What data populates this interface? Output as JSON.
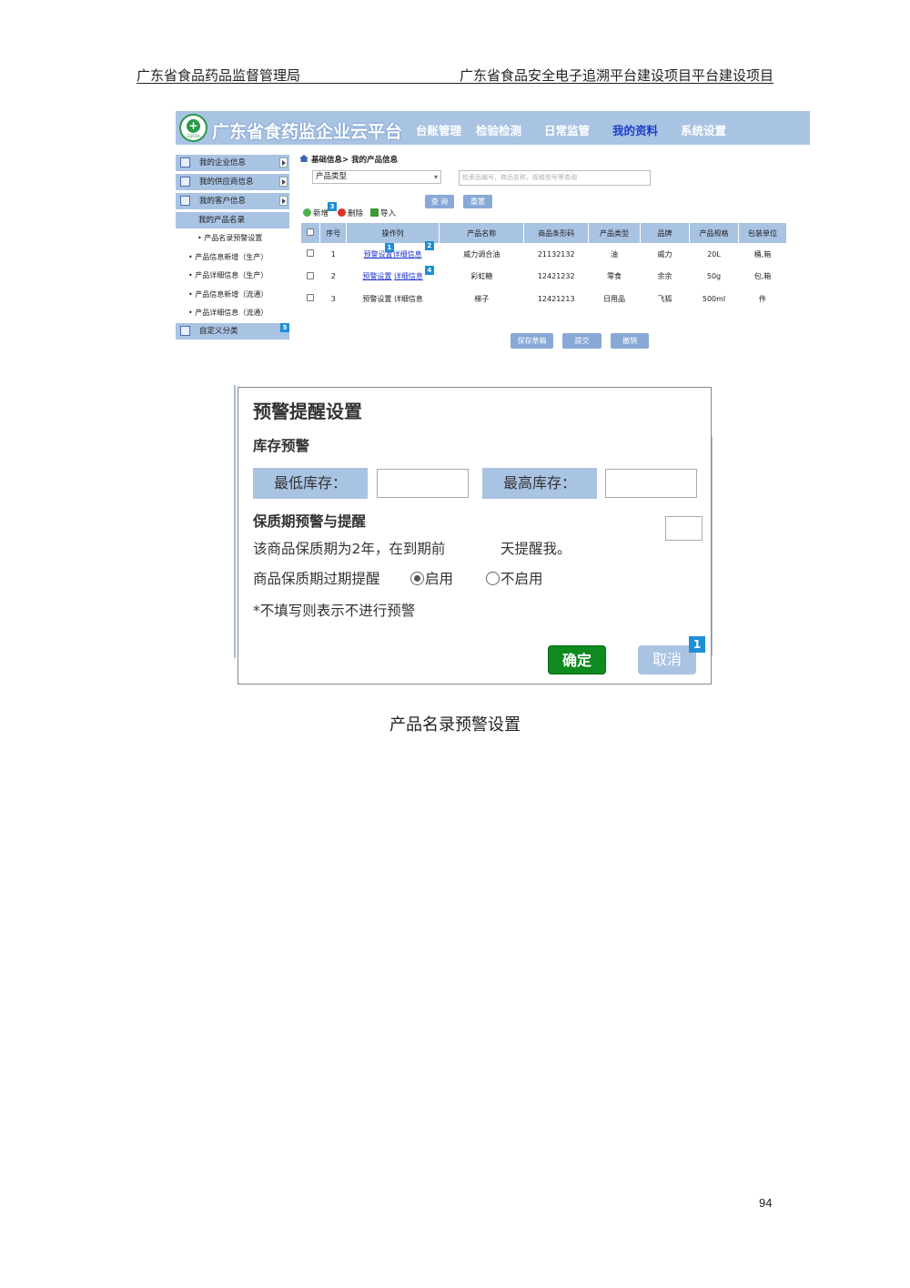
{
  "header": {
    "left": "广东省食品药品监督管理局",
    "right": "广东省食品安全电子追溯平台建设项目平台建设项目"
  },
  "app": {
    "logo_text": "GDFDA",
    "title": "广东省食药监企业云平台",
    "nav": [
      "台账管理",
      "检验检测",
      "日常监管",
      "我的资料",
      "系统设置"
    ],
    "active_nav": "我的资料"
  },
  "sidebar": {
    "boxed": [
      "我的企业信息",
      "我的供应商信息",
      "我的客户信息"
    ],
    "selected": "我的产品名录",
    "sub": [
      "• 产品名录预警设置",
      "• 产品信息新增（生产）",
      "• 产品详细信息（生产）",
      "• 产品信息新增（流通）",
      "• 产品详细信息（流通）"
    ],
    "custom": "自定义分类",
    "custom_badge": "5"
  },
  "content": {
    "breadcrumb": "基础信息> 我的产品信息",
    "category_select": "产品类型",
    "search_placeholder": "检索品编号，商品名称，规格型号等查询",
    "query_btn": "查 询",
    "reset_btn": "重置",
    "tools": {
      "add": "新增",
      "delete": "删除",
      "import": "导入",
      "add_badge": "3"
    },
    "columns": [
      "",
      "序号",
      "操作列",
      "产品名称",
      "商品条形码",
      "产品类型",
      "品牌",
      "产品规格",
      "包装单位"
    ],
    "rows": [
      {
        "no": "1",
        "op1": "预警设置",
        "op2": "详细信息",
        "name": "威力调合油",
        "barcode": "21132132",
        "type": "油",
        "brand": "威力",
        "spec": "20L",
        "unit": "桶,箱",
        "b1": "1",
        "b2": "2"
      },
      {
        "no": "2",
        "op1": "预警设置",
        "op2": "详细信息",
        "name": "彩虹糖",
        "barcode": "12421232",
        "type": "零食",
        "brand": "余余",
        "spec": "50g",
        "unit": "包,箱",
        "b1": "",
        "b2": "4"
      },
      {
        "no": "3",
        "op1": "预警设置",
        "op2": "详细信息",
        "name": "梯子",
        "barcode": "12421213",
        "type": "日用品",
        "brand": "飞狐",
        "spec": "500ml",
        "unit": "件",
        "b1": "",
        "b2": ""
      }
    ],
    "bottom_buttons": [
      "保存草稿",
      "提交",
      "撤销"
    ]
  },
  "dialog": {
    "title": "预警提醒设置",
    "stock_section": "库存预警",
    "min_label": "最低库存：",
    "max_label": "最高库存：",
    "min_value": "",
    "max_value": "",
    "shelf_section": "保质期预警与提醒",
    "shelf_text1": "该商品保质期为2年，在到期前",
    "shelf_text2": "天提醒我。",
    "days_value": "",
    "expire_label": "商品保质期过期提醒",
    "enable": "启用",
    "disable": "不启用",
    "selected": "启用",
    "note": "*不填写则表示不进行预警",
    "ok": "确定",
    "cancel": "取消",
    "cancel_badge": "1"
  },
  "caption": "产品名录预警设置",
  "page_number": "94"
}
